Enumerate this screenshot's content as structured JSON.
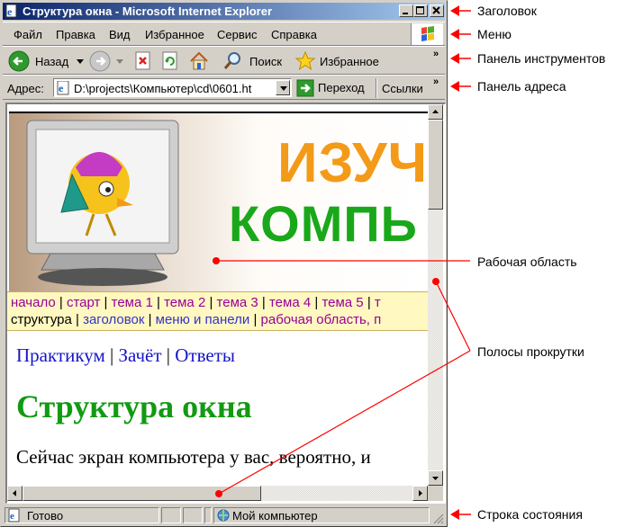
{
  "window": {
    "title": "Структура окна - Microsoft Internet Explorer"
  },
  "menu": [
    "Файл",
    "Правка",
    "Вид",
    "Избранное",
    "Сервис",
    "Справка"
  ],
  "toolbar": {
    "back_label": "Назад",
    "search_label": "Поиск",
    "favorites_label": "Избранное"
  },
  "address": {
    "label": "Адрес:",
    "value": "D:\\projects\\Компьютер\\cd\\0601.ht",
    "go_label": "Переход",
    "links_label": "Ссылки"
  },
  "page": {
    "banner_line1": "ИЗУЧА",
    "banner_line2": "КОМПЬ",
    "nav_row1": [
      {
        "text": "начало",
        "color": "purple"
      },
      {
        "text": "старт",
        "color": "purple"
      },
      {
        "text": "тема 1",
        "color": "purple"
      },
      {
        "text": "тема 2",
        "color": "purple"
      },
      {
        "text": "тема 3",
        "color": "purple"
      },
      {
        "text": "тема 4",
        "color": "purple"
      },
      {
        "text": "тема 5",
        "color": "purple"
      },
      {
        "text": "т",
        "color": "purple"
      }
    ],
    "nav_row2": [
      {
        "text": "структура",
        "color": "black"
      },
      {
        "text": "заголовок",
        "color": "blue"
      },
      {
        "text": "меню и панели",
        "color": "blue"
      },
      {
        "text": "рабочая область, п",
        "color": "purple"
      }
    ],
    "practicum_links": [
      "Практикум",
      "Зачёт",
      "Ответы"
    ],
    "heading": "Структура окна",
    "paragraph": "Сейчас экран компьютера у вас, вероятно, и"
  },
  "status": {
    "text": "Готово",
    "zone": "Мой компьютер"
  },
  "callouts": {
    "title": "Заголовок",
    "menu": "Меню",
    "toolbar": "Панель инструментов",
    "address": "Панель адреса",
    "workspace": "Рабочая область",
    "scrollbars": "Полосы прокрутки",
    "statusbar": "Строка состояния"
  },
  "colors": {
    "title_gradient_start": "#0a246a",
    "title_gradient_end": "#a6caf0",
    "annotation_red": "#ff0000",
    "heading_green": "#129a12",
    "link_blue": "#1515c8",
    "link_purple": "#990099"
  }
}
